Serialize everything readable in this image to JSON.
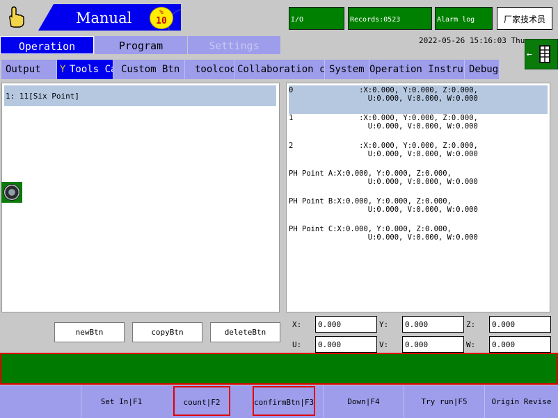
{
  "header": {
    "mode_title": "Manual",
    "speed_percent_symbol": "%",
    "speed_value": "10",
    "status_io": "I/O",
    "status_records": "Records:0523",
    "status_alarm": "Alarm log",
    "user": "厂家技术员",
    "datetime": "2022-05-26  15:16:03  Thu"
  },
  "main_tabs": [
    {
      "label": "Operation",
      "state": "active"
    },
    {
      "label": "Program",
      "state": "normal"
    },
    {
      "label": "Settings",
      "state": "disabled"
    }
  ],
  "sub_tabs": [
    {
      "label": "Output",
      "ghost": ""
    },
    {
      "label": "Tools Calibra",
      "ghost": "Y"
    },
    {
      "label": "Custom Btn",
      "ghost": ""
    },
    {
      "label": "toolcoord",
      "ghost": ""
    },
    {
      "label": "Collaboration co",
      "ghost": ""
    },
    {
      "label": "System Var",
      "ghost": ""
    },
    {
      "label": "Operation Instruc",
      "ghost": ""
    },
    {
      "label": "Debug",
      "ghost": ""
    }
  ],
  "tool_list": [
    {
      "label": "1: 11[Six Point]"
    }
  ],
  "points": [
    {
      "name": "0",
      "line1": "               :X:0.000, Y:0.000, Z:0.000,",
      "line2": "                  U:0.000, V:0.000, W:0.000"
    },
    {
      "name": "1",
      "line1": "               :X:0.000, Y:0.000, Z:0.000,",
      "line2": "                  U:0.000, V:0.000, W:0.000"
    },
    {
      "name": "2",
      "line1": "               :X:0.000, Y:0.000, Z:0.000,",
      "line2": "                  U:0.000, V:0.000, W:0.000"
    },
    {
      "name": "PH Point A",
      "line1": ":X:0.000, Y:0.000, Z:0.000,",
      "line2": "                  U:0.000, V:0.000, W:0.000"
    },
    {
      "name": "PH Point B",
      "line1": ":X:0.000, Y:0.000, Z:0.000,",
      "line2": "                  U:0.000, V:0.000, W:0.000"
    },
    {
      "name": "PH Point C",
      "line1": ":X:0.000, Y:0.000, Z:0.000,",
      "line2": "                  U:0.000, V:0.000, W:0.000"
    }
  ],
  "list_buttons": {
    "new": "newBtn",
    "copy": "copyBtn",
    "delete": "deleteBtn"
  },
  "coords": {
    "x_label": "X:",
    "x_value": "0.000",
    "y_label": "Y:",
    "y_value": "0.000",
    "z_label": "Z:",
    "z_value": "0.000",
    "u_label": "U:",
    "u_value": "0.000",
    "v_label": "V:",
    "v_value": "0.000",
    "w_label": "W:",
    "w_value": "0.000"
  },
  "function_keys": [
    {
      "label": ""
    },
    {
      "label": "Set In|F1"
    },
    {
      "label": "count|F2"
    },
    {
      "label": "confirmBtn|F3"
    },
    {
      "label": "Down|F4"
    },
    {
      "label": "Try run|F5"
    },
    {
      "label": "Origin Revise"
    }
  ],
  "colors": {
    "active_tab": "#0000ee",
    "tab_bg": "#9d9dec",
    "status_green": "#008000",
    "highlight_red": "#e00000",
    "selection": "#b6c8e0"
  },
  "icons": {
    "hand": "hand-pointer-icon",
    "speed": "speed-gauge-icon",
    "side": "panel-toggle-icon",
    "knob": "jog-knob-icon"
  }
}
